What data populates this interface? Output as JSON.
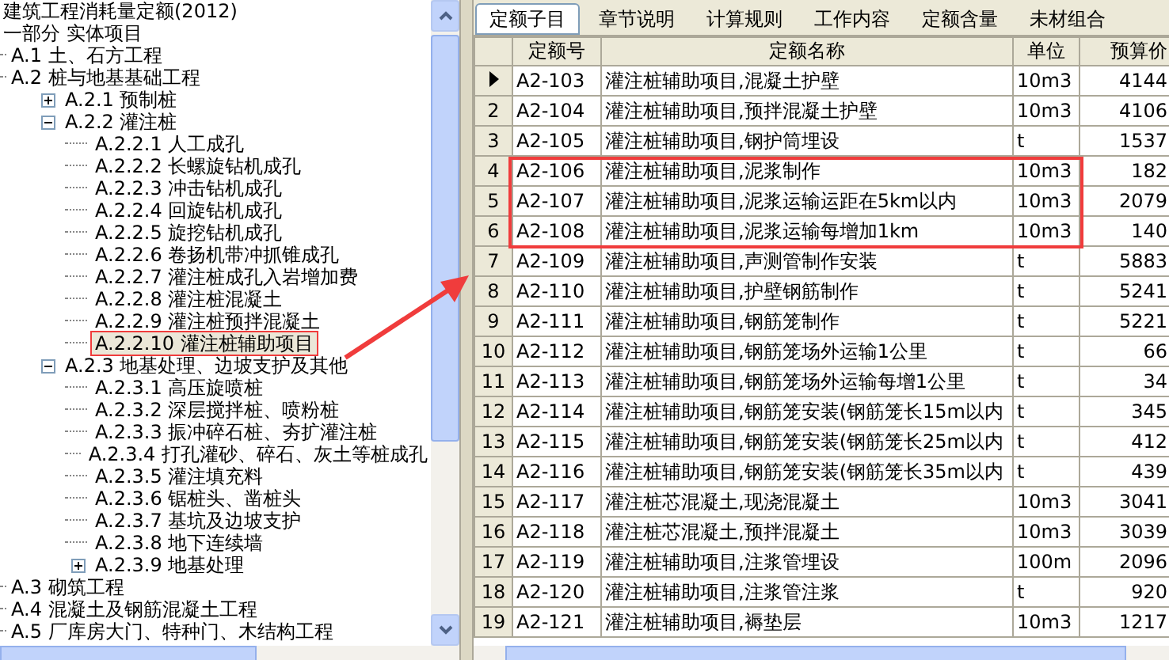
{
  "tree": {
    "items": [
      {
        "label": "建筑工程消耗量定额(2012)",
        "selected": false,
        "children": [
          {
            "label": "一部分 实体项目",
            "selected": false,
            "children": [
              {
                "label": "A.1 土、石方工程",
                "selected": false
              },
              {
                "label": "A.2 桩与地基基础工程",
                "selected": false,
                "children": [
                  {
                    "label": "A.2.1 预制桩",
                    "selected": false,
                    "expanded": false
                  },
                  {
                    "label": "A.2.2 灌注桩",
                    "selected": false,
                    "expanded": true,
                    "children": [
                      {
                        "label": "A.2.2.1 人工成孔",
                        "selected": false
                      },
                      {
                        "label": "A.2.2.2 长螺旋钻机成孔",
                        "selected": false
                      },
                      {
                        "label": "A.2.2.3 冲击钻机成孔",
                        "selected": false
                      },
                      {
                        "label": "A.2.2.4 回旋钻机成孔",
                        "selected": false
                      },
                      {
                        "label": "A.2.2.5 旋挖钻机成孔",
                        "selected": false
                      },
                      {
                        "label": "A.2.2.6 卷扬机带冲抓锥成孔",
                        "selected": false
                      },
                      {
                        "label": "A.2.2.7 灌注桩成孔入岩增加费",
                        "selected": false
                      },
                      {
                        "label": "A.2.2.8 灌注桩混凝土",
                        "selected": false
                      },
                      {
                        "label": "A.2.2.9 灌注桩预拌混凝土",
                        "selected": false
                      },
                      {
                        "label": "A.2.2.10 灌注桩辅助项目",
                        "selected": true
                      }
                    ]
                  },
                  {
                    "label": "A.2.3 地基处理、边坡支护及其他",
                    "selected": false,
                    "expanded": true,
                    "children": [
                      {
                        "label": "A.2.3.1 高压旋喷桩",
                        "selected": false
                      },
                      {
                        "label": "A.2.3.2 深层搅拌桩、喷粉桩",
                        "selected": false
                      },
                      {
                        "label": "A.2.3.3 振冲碎石桩、夯扩灌注桩",
                        "selected": false
                      },
                      {
                        "label": "A.2.3.4 打孔灌砂、碎石、灰土等桩成孔",
                        "selected": false
                      },
                      {
                        "label": "A.2.3.5 灌注填充料",
                        "selected": false
                      },
                      {
                        "label": "A.2.3.6 锯桩头、凿桩头",
                        "selected": false
                      },
                      {
                        "label": "A.2.3.7 基坑及边坡支护",
                        "selected": false
                      },
                      {
                        "label": "A.2.3.8 地下连续墙",
                        "selected": false
                      },
                      {
                        "label": "A.2.3.9 地基处理",
                        "selected": false,
                        "expanded": false
                      }
                    ]
                  }
                ]
              },
              {
                "label": "A.3 砌筑工程",
                "selected": false
              },
              {
                "label": "A.4 混凝土及钢筋混凝土工程",
                "selected": false
              },
              {
                "label": "A.5 厂库房大门、特种门、木结构工程",
                "selected": false
              }
            ]
          }
        ]
      }
    ]
  },
  "tabs": [
    {
      "label": "定额子目",
      "selected": true
    },
    {
      "label": "章节说明",
      "selected": false
    },
    {
      "label": "计算规则",
      "selected": false
    },
    {
      "label": "工作内容",
      "selected": false
    },
    {
      "label": "定额含量",
      "selected": false
    },
    {
      "label": "未材组合",
      "selected": false
    }
  ],
  "table": {
    "columns": [
      "定额号",
      "定额名称",
      "单位",
      "预算价"
    ],
    "rows": [
      {
        "current": true,
        "cells": [
          "A2-103",
          "灌注桩辅助项目,混凝土护壁",
          "10m3",
          "4144"
        ]
      },
      {
        "current": false,
        "num": "2",
        "cells": [
          "A2-104",
          "灌注桩辅助项目,预拌混凝土护壁",
          "10m3",
          "4106"
        ]
      },
      {
        "current": false,
        "num": "3",
        "cells": [
          "A2-105",
          "灌注桩辅助项目,钢护筒埋设",
          "t",
          "1537"
        ]
      },
      {
        "current": false,
        "num": "4",
        "cells": [
          "A2-106",
          "灌注桩辅助项目,泥浆制作",
          "10m3",
          "182"
        ]
      },
      {
        "current": false,
        "num": "5",
        "cells": [
          "A2-107",
          "灌注桩辅助项目,泥浆运输运距在5km以内",
          "10m3",
          "2079"
        ]
      },
      {
        "current": false,
        "num": "6",
        "cells": [
          "A2-108",
          "灌注桩辅助项目,泥浆运输每增加1km",
          "10m3",
          "140"
        ]
      },
      {
        "current": false,
        "num": "7",
        "cells": [
          "A2-109",
          "灌注桩辅助项目,声测管制作安装",
          "t",
          "5883"
        ]
      },
      {
        "current": false,
        "num": "8",
        "cells": [
          "A2-110",
          "灌注桩辅助项目,护壁钢筋制作",
          "t",
          "5241"
        ]
      },
      {
        "current": false,
        "num": "9",
        "cells": [
          "A2-111",
          "灌注桩辅助项目,钢筋笼制作",
          "t",
          "5221"
        ]
      },
      {
        "current": false,
        "num": "10",
        "cells": [
          "A2-112",
          "灌注桩辅助项目,钢筋笼场外运输1公里",
          "t",
          "66"
        ]
      },
      {
        "current": false,
        "num": "11",
        "cells": [
          "A2-113",
          "灌注桩辅助项目,钢筋笼场外运输每增1公里",
          "t",
          "34"
        ]
      },
      {
        "current": false,
        "num": "12",
        "cells": [
          "A2-114",
          "灌注桩辅助项目,钢筋笼安装(钢筋笼长15m以内",
          "t",
          "345"
        ]
      },
      {
        "current": false,
        "num": "13",
        "cells": [
          "A2-115",
          "灌注桩辅助项目,钢筋笼安装(钢筋笼长25m以内",
          "t",
          "412"
        ]
      },
      {
        "current": false,
        "num": "14",
        "cells": [
          "A2-116",
          "灌注桩辅助项目,钢筋笼安装(钢筋笼长35m以内",
          "t",
          "439"
        ]
      },
      {
        "current": false,
        "num": "15",
        "cells": [
          "A2-117",
          "灌注桩芯混凝土,现浇混凝土",
          "10m3",
          "3041"
        ]
      },
      {
        "current": false,
        "num": "16",
        "cells": [
          "A2-118",
          "灌注桩芯混凝土,预拌混凝土",
          "10m3",
          "3039"
        ]
      },
      {
        "current": false,
        "num": "17",
        "cells": [
          "A2-119",
          "灌注桩辅助项目,注浆管埋设",
          "100m",
          "2096"
        ]
      },
      {
        "current": false,
        "num": "18",
        "cells": [
          "A2-120",
          "灌注桩辅助项目,注浆管注浆",
          "t",
          "920"
        ]
      },
      {
        "current": false,
        "num": "19",
        "cells": [
          "A2-121",
          "灌注桩辅助项目,褥垫层",
          "10m3",
          "1217"
        ]
      }
    ]
  }
}
